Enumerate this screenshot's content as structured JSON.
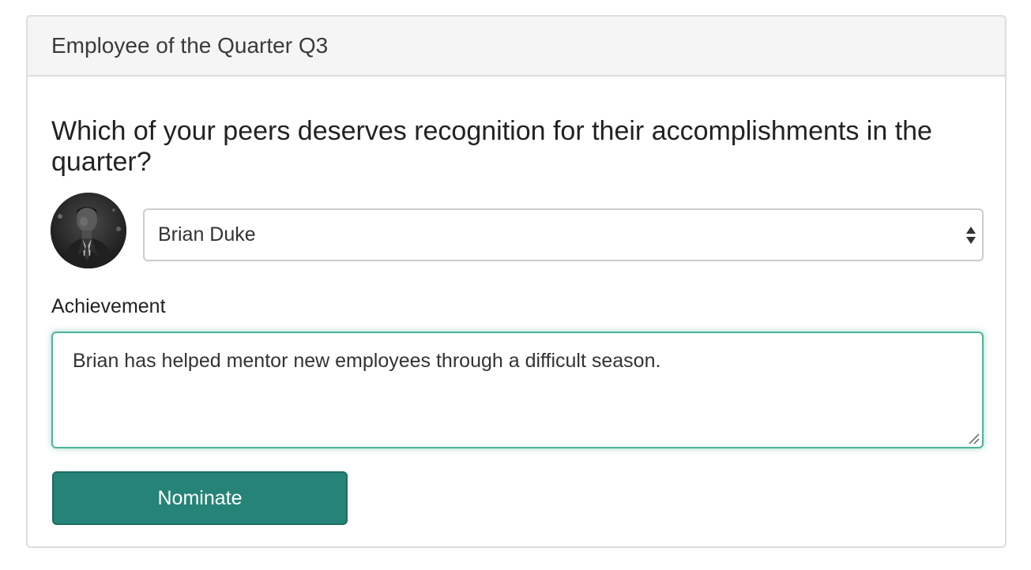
{
  "card": {
    "title": "Employee of the Quarter Q3"
  },
  "form": {
    "question": "Which of your peers deserves recognition for their accomplishments in the quarter?",
    "nominee": {
      "selected": "Brian Duke",
      "avatar_icon": "person-photo-avatar"
    },
    "achievement": {
      "label": "Achievement",
      "value": "Brian has helped mentor new employees through a difficult season."
    },
    "submit_label": "Nominate"
  },
  "colors": {
    "accent": "#258477",
    "focus_border": "#4fb39a",
    "header_bg": "#f5f5f5"
  }
}
